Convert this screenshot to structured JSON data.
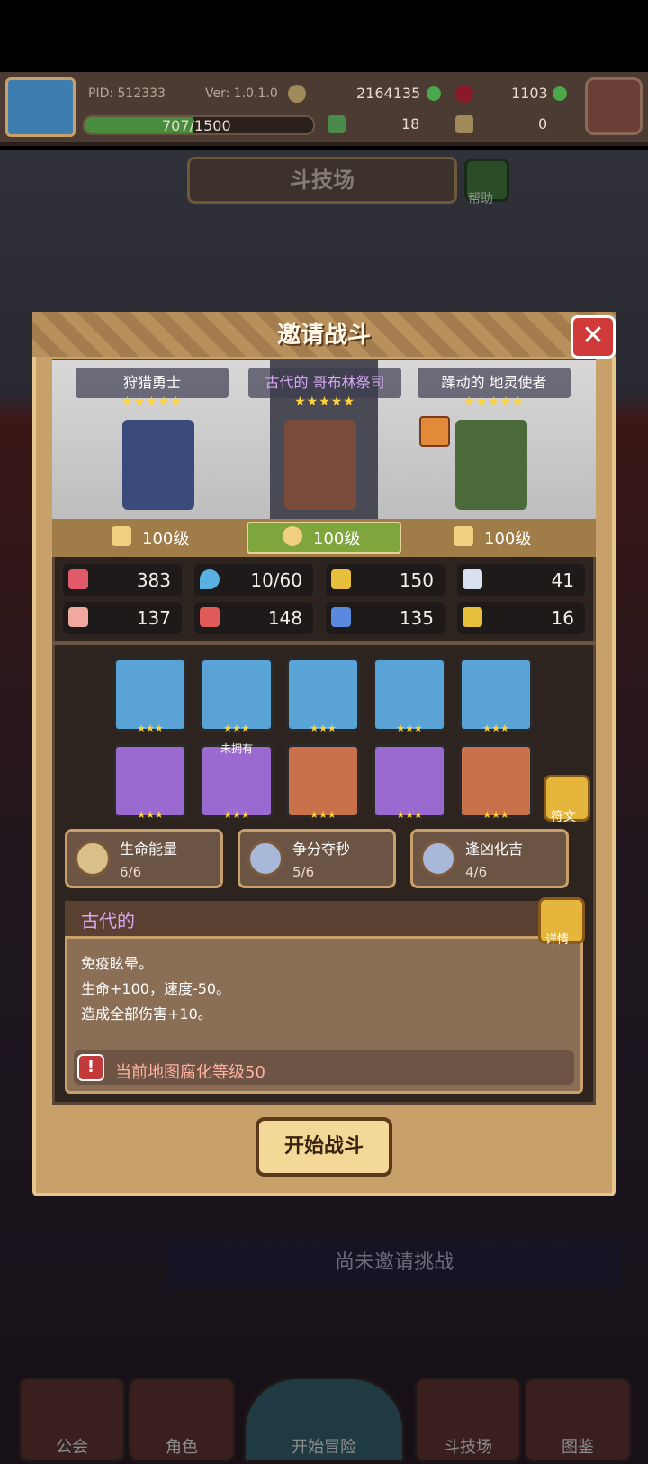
{
  "hud": {
    "pid": "PID: 512333",
    "version": "Ver: 1.0.1.0",
    "gold": "2164135",
    "gems": "1103",
    "exp": "707/1500",
    "exp_progress": 0.471,
    "clover": "18",
    "keys": "0"
  },
  "arena": {
    "title": "斗技场",
    "help_label": "帮助"
  },
  "modal": {
    "title": "邀请战斗",
    "close_label": "✕",
    "units": [
      {
        "name": "狩猎勇士",
        "stars": "★★★★★",
        "level": "100级"
      },
      {
        "name": "古代的 哥布林祭司",
        "stars": "★★★★★",
        "level": "100级"
      },
      {
        "name": "躁动的 地灵使者",
        "stars": "★★★★★",
        "level": "100级"
      }
    ],
    "stats": [
      "383",
      "10/60",
      "150",
      "41",
      "137",
      "148",
      "135",
      "16"
    ],
    "equip_stars": "★★★",
    "not_owned": "未拥有",
    "rune_label": "符文",
    "skills": [
      {
        "name": "生命能量",
        "count": "6/6"
      },
      {
        "name": "争分夺秒",
        "count": "5/6"
      },
      {
        "name": "逢凶化吉",
        "count": "4/6"
      }
    ],
    "desc": {
      "title": "古代的",
      "detail_label": "详情",
      "lines": [
        "免疫眩晕。",
        "生命+100，速度-50。",
        "造成全部伤害+10。"
      ],
      "warning": "当前地图腐化等级50"
    },
    "start_label": "开始战斗"
  },
  "no_challenge": "尚未邀请挑战",
  "nav": [
    "公会",
    "角色",
    "开始冒险",
    "斗技场",
    "图鉴"
  ]
}
